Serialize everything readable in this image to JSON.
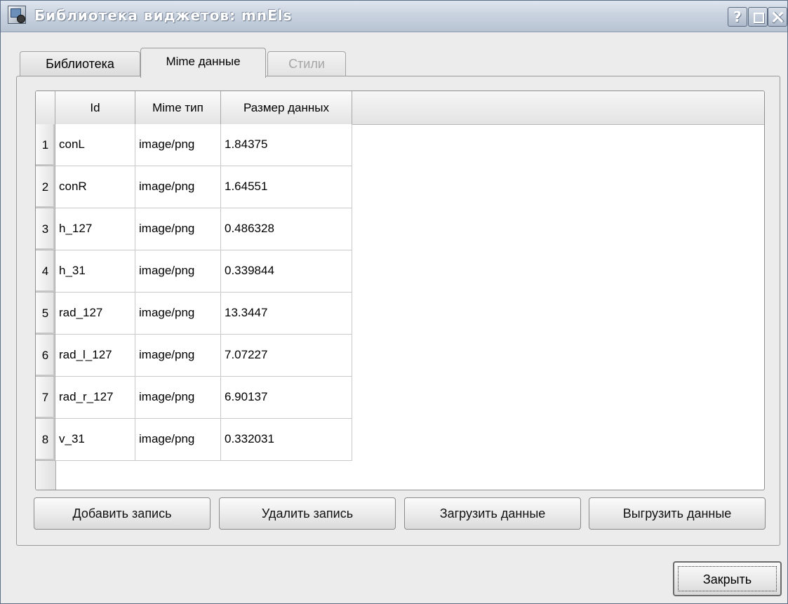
{
  "window": {
    "title": "Библиотека виджетов: mnEls",
    "help_glyph": "?",
    "colors": {
      "titlebar": "#c9d3e0",
      "title_text": "#ffffff",
      "background": "#ececec"
    }
  },
  "tabs": [
    {
      "label": "Библиотека",
      "state": "normal"
    },
    {
      "label": "Mime данные",
      "state": "active"
    },
    {
      "label": "Стили",
      "state": "disabled"
    }
  ],
  "table": {
    "columns": [
      "Id",
      "Mime тип",
      "Размер данных"
    ],
    "rows": [
      {
        "num": "1",
        "id": "conL",
        "mime": "image/png",
        "size": "1.84375"
      },
      {
        "num": "2",
        "id": "conR",
        "mime": "image/png",
        "size": "1.64551"
      },
      {
        "num": "3",
        "id": "h_127",
        "mime": "image/png",
        "size": "0.486328"
      },
      {
        "num": "4",
        "id": "h_31",
        "mime": "image/png",
        "size": "0.339844"
      },
      {
        "num": "5",
        "id": "rad_127",
        "mime": "image/png",
        "size": "13.3447"
      },
      {
        "num": "6",
        "id": "rad_l_127",
        "mime": "image/png",
        "size": "7.07227"
      },
      {
        "num": "7",
        "id": "rad_r_127",
        "mime": "image/png",
        "size": "6.90137"
      },
      {
        "num": "8",
        "id": "v_31",
        "mime": "image/png",
        "size": "0.332031"
      }
    ]
  },
  "buttons": {
    "add": "Добавить запись",
    "delete": "Удалить запись",
    "load": "Загрузить данные",
    "unload": "Выгрузить данные",
    "close": "Закрыть"
  }
}
